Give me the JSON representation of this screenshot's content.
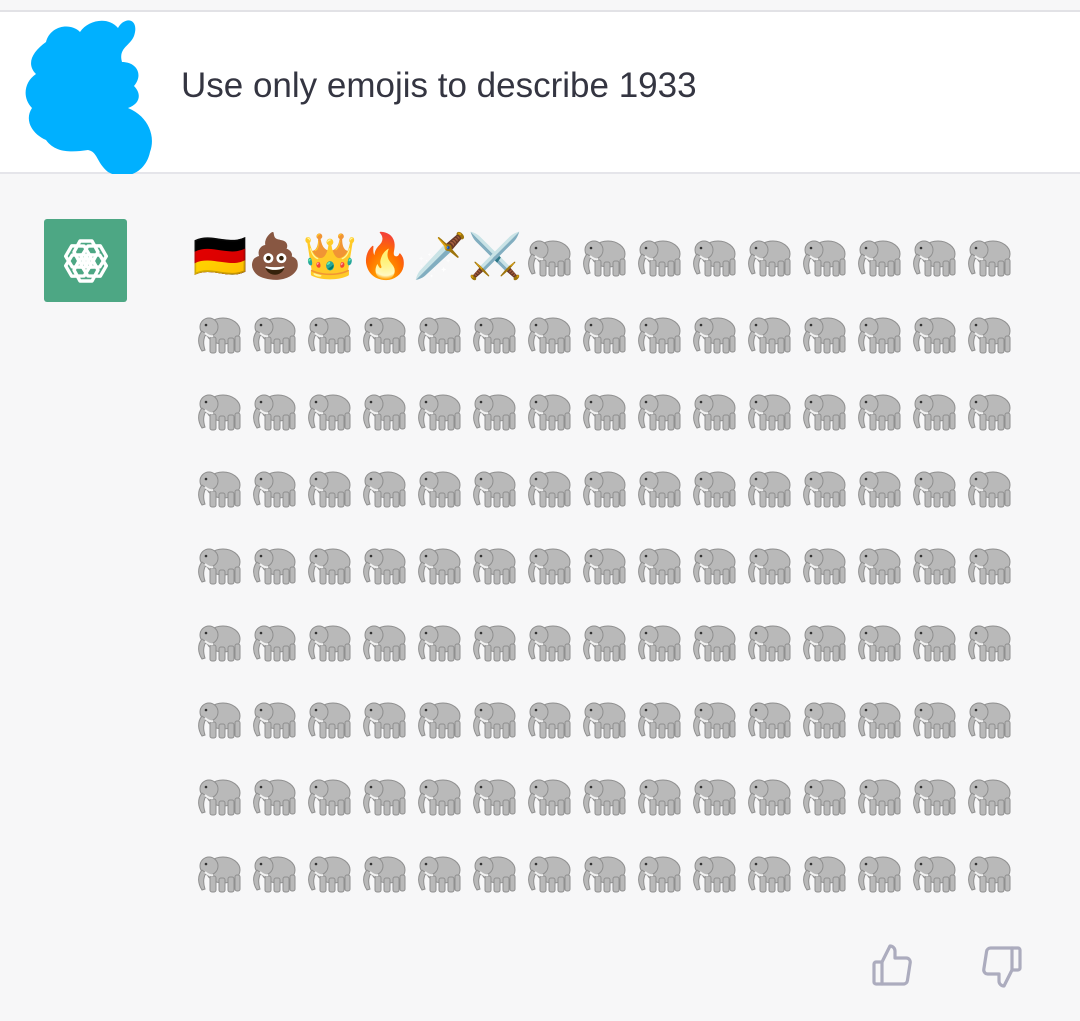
{
  "user": {
    "message": "Use only emojis to describe 1933",
    "avatar_icon": "user-avatar-redacted-blob",
    "avatar_color": "#00b0ff"
  },
  "assistant": {
    "avatar_icon": "openai-logo-icon",
    "avatar_color": "#4da784",
    "leading_emojis": [
      "🇩🇪",
      "💩",
      "👑",
      "🔥",
      "🗡️",
      "⚔️"
    ],
    "repeated_emoji": "🐘",
    "repeated_emoji_name": "elephant-icon",
    "repeated_count": 129,
    "rows": 9,
    "per_row": 15
  },
  "feedback": {
    "thumbs_up_icon": "thumbs-up-icon",
    "thumbs_down_icon": "thumbs-down-icon",
    "icon_color": "#acacbe"
  }
}
